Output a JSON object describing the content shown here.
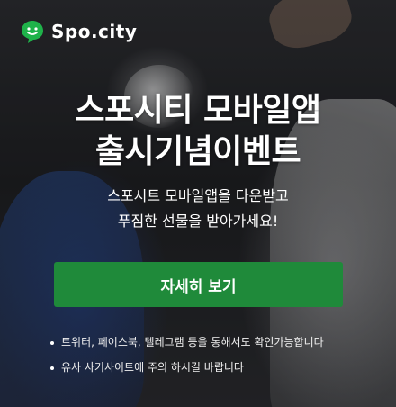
{
  "brand": {
    "name": "Spo.city",
    "accent": "#1f8a3a",
    "logo_green": "#1fb24a"
  },
  "headline": {
    "line1": "스포시티 모바일앱",
    "line2": "출시기념이벤트"
  },
  "subtext": {
    "line1": "스포시트 모바일앱을 다운받고",
    "line2": "푸짐한 선물을 받아가세요!"
  },
  "cta": {
    "label": "자세히 보기"
  },
  "notes": [
    "트위터, 페이스북, 텔레그램 등을 통해서도 확인가능합니다",
    "유사 사기사이트에 주의 하시길 바랍니다"
  ]
}
